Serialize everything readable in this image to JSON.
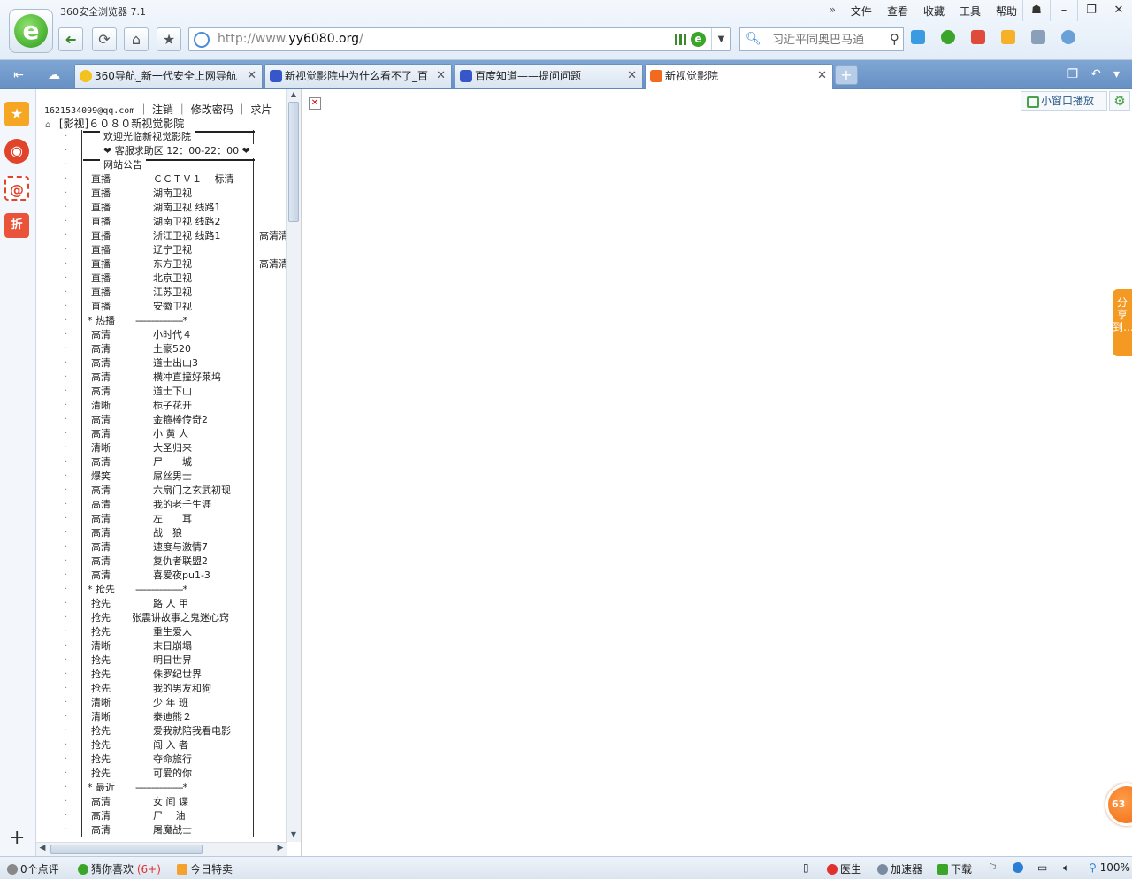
{
  "app": {
    "title": "360安全浏览器 7.1",
    "menu": [
      "文件",
      "查看",
      "收藏",
      "工具",
      "帮助"
    ],
    "menu_more": "»",
    "window_controls": [
      "☗",
      "–",
      "❐",
      "✕"
    ],
    "nav": {
      "back": "➜",
      "refresh": "⟳",
      "home": "⌂",
      "favorite": "★"
    }
  },
  "address": {
    "url_prefix": "http://www.",
    "url_domain": "yy6080.org",
    "url_suffix": "/"
  },
  "search": {
    "placeholder": "习近平同奥巴马通"
  },
  "tabs": [
    {
      "label": "360导航_新一代安全上网导航",
      "close": "✕"
    },
    {
      "label": "新视觉影院中为什么看不了_百",
      "close": "✕"
    },
    {
      "label": "百度知道——提问问题",
      "close": "✕"
    },
    {
      "label": "新视觉影院",
      "close": "✕"
    }
  ],
  "tab_add": "+",
  "frame": {
    "account": {
      "email": "1621534099@qq.com",
      "links": [
        "注销",
        "修改密码",
        "求片"
      ],
      "sep": "｜"
    },
    "root": "[影视]６０８０新视觉影院",
    "header_rows": [
      "欢迎光临新视觉影院",
      "❤ 客服求助区 12：00-22：00 ❤",
      "网站公告"
    ],
    "live": [
      {
        "tag": "直播",
        "name": "ＣＣＴＶ１　 标清",
        "extra": ""
      },
      {
        "tag": "直播",
        "name": "湖南卫视",
        "extra": ""
      },
      {
        "tag": "直播",
        "name": "湖南卫视 线路1",
        "extra": ""
      },
      {
        "tag": "直播",
        "name": "湖南卫视 线路2",
        "extra": ""
      },
      {
        "tag": "直播",
        "name": "浙江卫视 线路1",
        "extra": "高清清"
      },
      {
        "tag": "直播",
        "name": "辽宁卫视",
        "extra": ""
      },
      {
        "tag": "直播",
        "name": "东方卫视",
        "extra": "高清清"
      },
      {
        "tag": "直播",
        "name": "北京卫视",
        "extra": ""
      },
      {
        "tag": "直播",
        "name": "江苏卫视",
        "extra": ""
      },
      {
        "tag": "直播",
        "name": "安徽卫视",
        "extra": ""
      }
    ],
    "section_hot": "* 热播",
    "hot": [
      {
        "tag": "高清",
        "name": "小时代４"
      },
      {
        "tag": "高清",
        "name": "土豪520"
      },
      {
        "tag": "高清",
        "name": "道士出山3"
      },
      {
        "tag": "高清",
        "name": "横冲直撞好莱坞"
      },
      {
        "tag": "高清",
        "name": "道士下山"
      },
      {
        "tag": "清晰",
        "name": "栀子花开"
      },
      {
        "tag": "高清",
        "name": "金箍棒传奇2"
      },
      {
        "tag": "高清",
        "name": "小 黄 人"
      },
      {
        "tag": "清晰",
        "name": "大圣归来"
      },
      {
        "tag": "高清",
        "name": "尸　　城"
      },
      {
        "tag": "爆笑",
        "name": "屌丝男士"
      },
      {
        "tag": "高清",
        "name": "六扇门之玄武初现"
      },
      {
        "tag": "高清",
        "name": "我的老千生涯"
      },
      {
        "tag": "高清",
        "name": "左　　耳"
      },
      {
        "tag": "高清",
        "name": "战　狼"
      },
      {
        "tag": "高清",
        "name": "速度与激情7"
      },
      {
        "tag": "高清",
        "name": "复仇者联盟2"
      },
      {
        "tag": "高清",
        "name": "喜爱夜pu1-3"
      }
    ],
    "section_first": "* 抢先",
    "first": [
      {
        "tag": "抢先",
        "name": "路 人 甲"
      },
      {
        "tag": "抢先",
        "name": "张震讲故事之鬼迷心窍",
        "wide": true
      },
      {
        "tag": "抢先",
        "name": "重生爱人"
      },
      {
        "tag": "清晰",
        "name": "末日崩塌"
      },
      {
        "tag": "抢先",
        "name": "明日世界"
      },
      {
        "tag": "抢先",
        "name": "侏罗纪世界"
      },
      {
        "tag": "抢先",
        "name": "我的男友和狗"
      },
      {
        "tag": "清晰",
        "name": "少 年 班"
      },
      {
        "tag": "清晰",
        "name": "泰迪熊２"
      },
      {
        "tag": "抢先",
        "name": "爱我就陪我看电影"
      },
      {
        "tag": "抢先",
        "name": "闯 入 者"
      },
      {
        "tag": "抢先",
        "name": "夺命旅行"
      },
      {
        "tag": "抢先",
        "name": "可爱的你"
      }
    ],
    "section_recent": "* 最近",
    "recent": [
      {
        "tag": "高清",
        "name": "女 间 谍"
      },
      {
        "tag": "高清",
        "name": "尸　 油"
      },
      {
        "tag": "高清",
        "name": "屠魔战士"
      }
    ],
    "dash": "------------------*"
  },
  "main": {
    "mini_play": "小窗口播放",
    "share": "分享到…",
    "badge": "63"
  },
  "status": {
    "comments": "0个点评",
    "guess_like": "猜你喜欢",
    "guess_count": "(6+)",
    "deals": "今日特卖",
    "doctor": "医生",
    "accelerator": "加速器",
    "download": "下载",
    "zoom": "100%"
  },
  "colors": {
    "tabbar": "#6790c4",
    "accent_green": "#3ba52a",
    "share_orange": "#f49a23"
  }
}
